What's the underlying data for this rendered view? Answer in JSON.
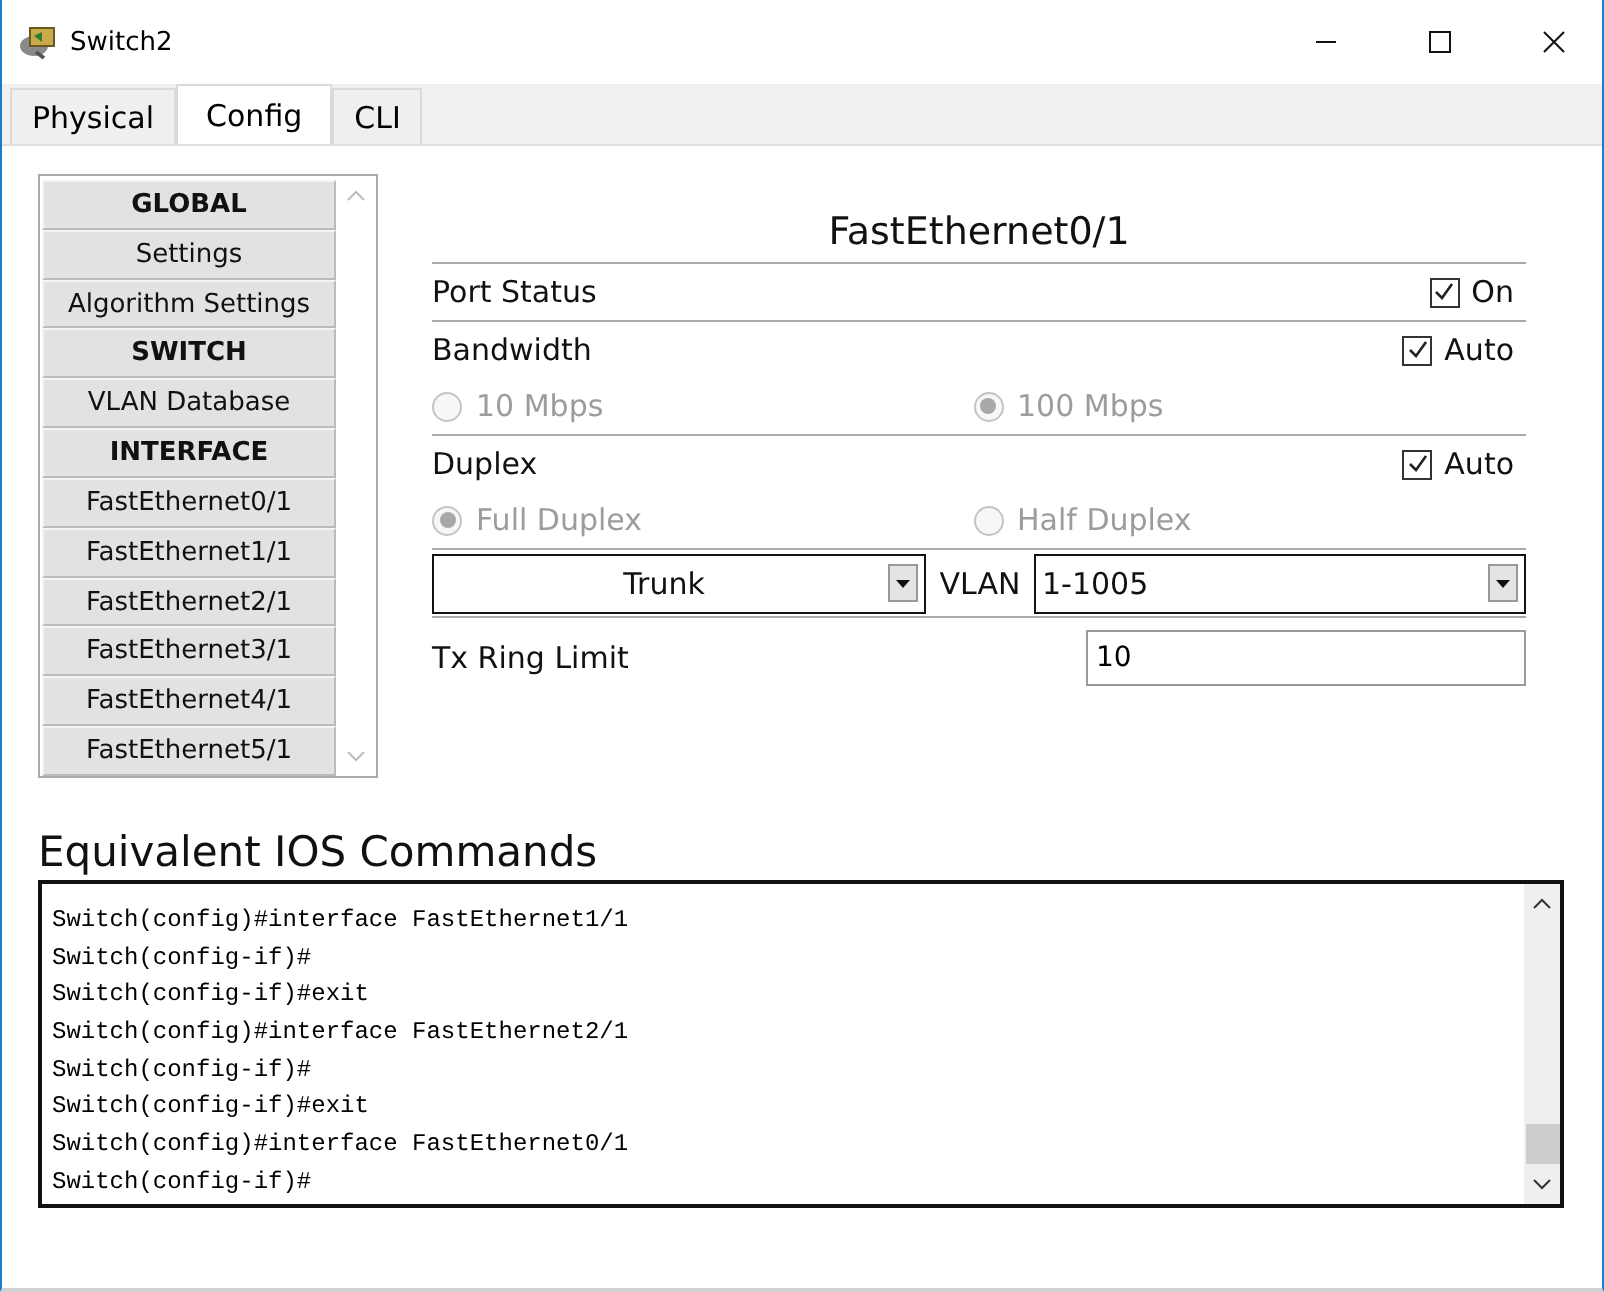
{
  "window": {
    "title": "Switch2"
  },
  "tabs": [
    {
      "label": "Physical",
      "selected": false
    },
    {
      "label": "Config",
      "selected": true
    },
    {
      "label": "CLI",
      "selected": false
    }
  ],
  "sidebar": {
    "items": [
      {
        "kind": "header",
        "label": "GLOBAL"
      },
      {
        "kind": "item",
        "label": "Settings"
      },
      {
        "kind": "item",
        "label": "Algorithm Settings"
      },
      {
        "kind": "header",
        "label": "SWITCH"
      },
      {
        "kind": "item",
        "label": "VLAN Database"
      },
      {
        "kind": "header",
        "label": "INTERFACE"
      },
      {
        "kind": "item",
        "label": "FastEthernet0/1"
      },
      {
        "kind": "item",
        "label": "FastEthernet1/1"
      },
      {
        "kind": "item",
        "label": "FastEthernet2/1"
      },
      {
        "kind": "item",
        "label": "FastEthernet3/1"
      },
      {
        "kind": "item",
        "label": "FastEthernet4/1"
      },
      {
        "kind": "item",
        "label": "FastEthernet5/1"
      }
    ]
  },
  "interface": {
    "title": "FastEthernet0/1",
    "port_status": {
      "label": "Port Status",
      "checkbox": {
        "label": "On",
        "checked": true
      }
    },
    "bandwidth": {
      "label": "Bandwidth",
      "checkbox": {
        "label": "Auto",
        "checked": true
      },
      "options": [
        {
          "label": "10 Mbps",
          "selected": false,
          "disabled": true
        },
        {
          "label": "100 Mbps",
          "selected": true,
          "disabled": true
        }
      ]
    },
    "duplex": {
      "label": "Duplex",
      "checkbox": {
        "label": "Auto",
        "checked": true
      },
      "options": [
        {
          "label": "Full Duplex",
          "selected": true,
          "disabled": true
        },
        {
          "label": "Half Duplex",
          "selected": false,
          "disabled": true
        }
      ]
    },
    "mode": {
      "value": "Trunk"
    },
    "vlan": {
      "label": "VLAN",
      "value": "1-1005"
    },
    "tx_ring_limit": {
      "label": "Tx Ring Limit",
      "value": "10"
    }
  },
  "commands": {
    "title": "Equivalent IOS Commands",
    "lines": [
      "Switch(config)#interface FastEthernet1/1",
      "Switch(config-if)#",
      "Switch(config-if)#exit",
      "Switch(config)#interface FastEthernet2/1",
      "Switch(config-if)#",
      "Switch(config-if)#exit",
      "Switch(config)#interface FastEthernet0/1",
      "Switch(config-if)#"
    ]
  }
}
